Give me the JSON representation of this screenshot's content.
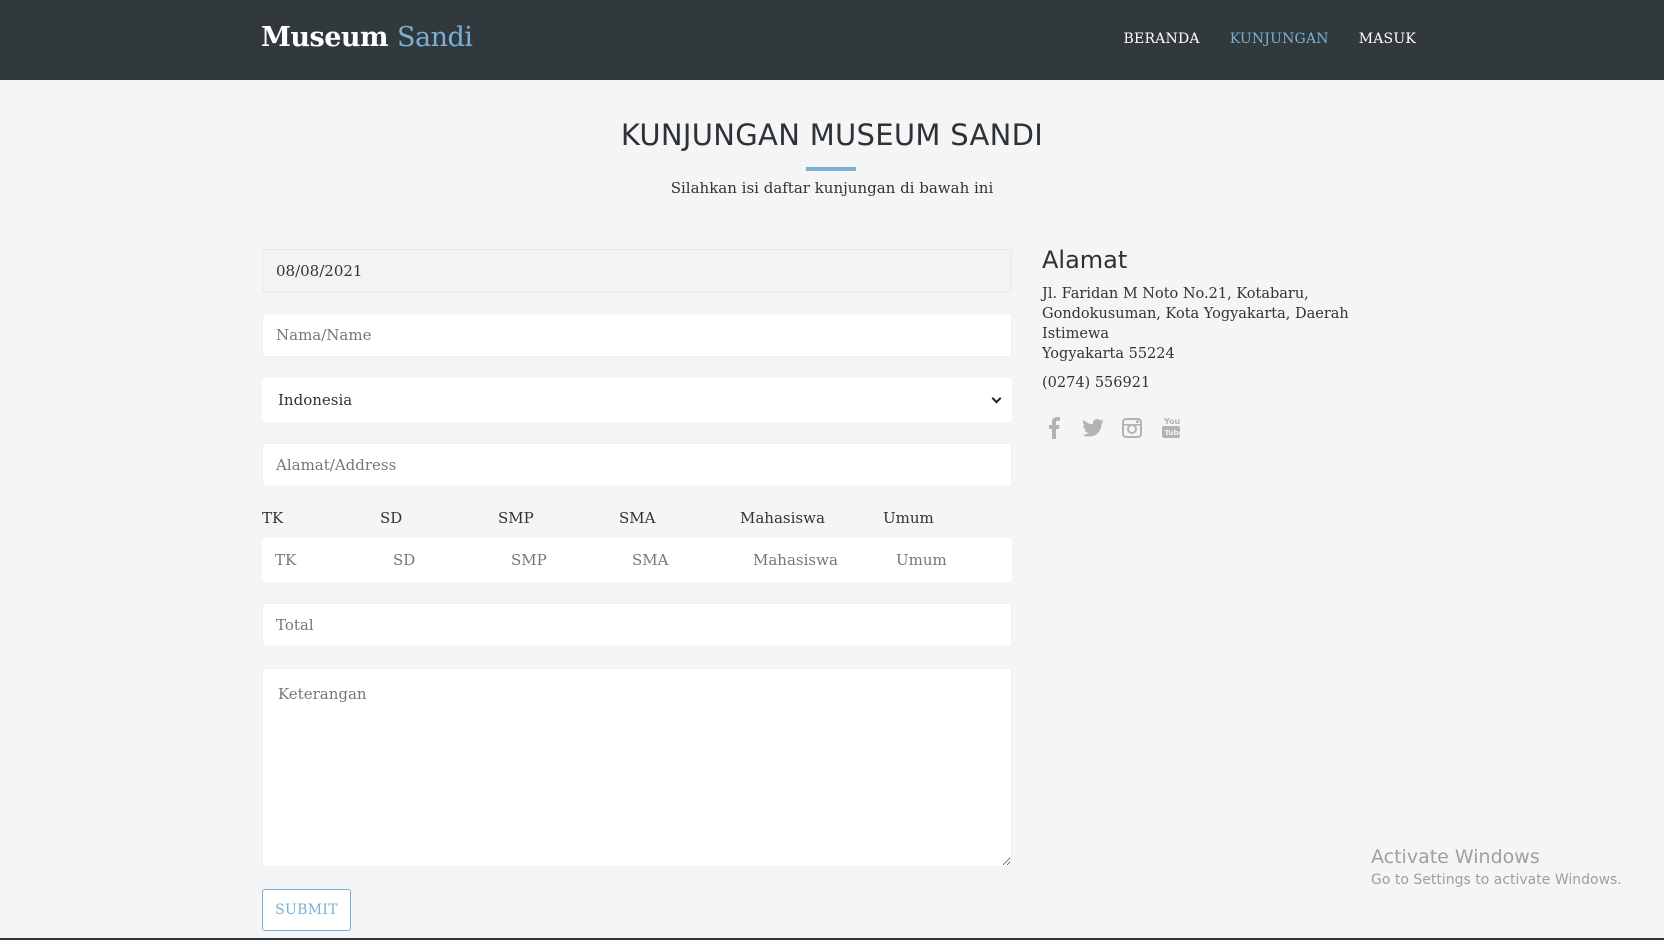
{
  "brand": {
    "part1": "Museum",
    "part2": "Sandi"
  },
  "nav": {
    "items": [
      {
        "label": "BERANDA",
        "active": false
      },
      {
        "label": "KUNJUNGAN",
        "active": true
      },
      {
        "label": "MASUK",
        "active": false
      }
    ]
  },
  "heading": {
    "title": "KUNJUNGAN MUSEUM SANDI",
    "subtitle": "Silahkan isi daftar kunjungan di bawah ini"
  },
  "form": {
    "date_value": "08/08/2021",
    "name_placeholder": "Nama/Name",
    "country_selected": "Indonesia",
    "address_placeholder": "Alamat/Address",
    "categories": [
      {
        "label": "TK",
        "placeholder": "TK"
      },
      {
        "label": "SD",
        "placeholder": "SD"
      },
      {
        "label": "SMP",
        "placeholder": "SMP"
      },
      {
        "label": "SMA",
        "placeholder": "SMA"
      },
      {
        "label": "Mahasiswa",
        "placeholder": "Mahasiswa"
      },
      {
        "label": "Umum",
        "placeholder": "Umum"
      }
    ],
    "total_placeholder": "Total",
    "notes_placeholder": "Keterangan",
    "submit_label": "SUBMIT"
  },
  "sidebar": {
    "heading": "Alamat",
    "address_line1": "Jl. Faridan M Noto No.21, Kotabaru,",
    "address_line2": "Gondokusuman, Kota Yogyakarta, Daerah Istimewa",
    "address_line3": "Yogyakarta 55224",
    "phone": "(0274) 556921",
    "social_icons": [
      "facebook-icon",
      "twitter-icon",
      "instagram-icon",
      "youtube-icon"
    ]
  },
  "watermark": {
    "line1": "Activate Windows",
    "line2": "Go to Settings to activate Windows."
  },
  "colors": {
    "navbar": "#32393d",
    "accent": "#79b1d4",
    "background": "#f5f5f5"
  }
}
